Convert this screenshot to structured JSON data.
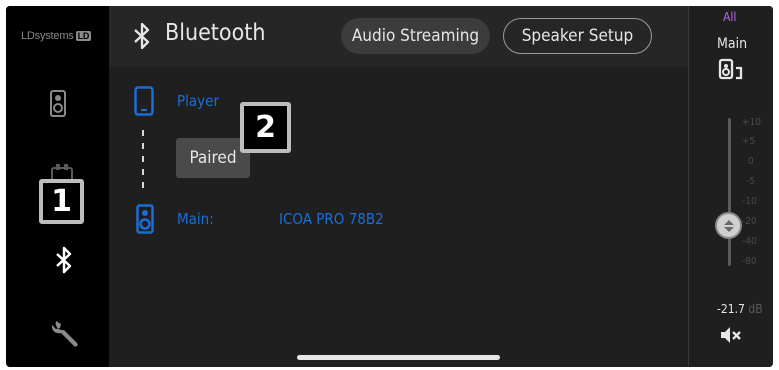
{
  "sidebar": {
    "logo_text": "LDsystems",
    "logo_badge": "LD",
    "items": [
      {
        "icon": "speaker-icon"
      },
      {
        "icon": "speaker-icon"
      },
      {
        "icon": "bluetooth-icon"
      },
      {
        "icon": "wrench-icon"
      }
    ]
  },
  "header": {
    "title": "Bluetooth",
    "tabs": [
      {
        "label": "Audio Streaming",
        "active": true
      },
      {
        "label": "Speaker Setup",
        "active": false
      }
    ]
  },
  "connection": {
    "player_label": "Player",
    "status": "Paired",
    "main_label": "Main:",
    "device_name": "ICOA PRO 78B2"
  },
  "annotations": {
    "badge_1": "1",
    "badge_2": "2"
  },
  "right_panel": {
    "group": "All",
    "channel": "Main",
    "ticks": [
      "+10",
      "+5",
      "0",
      "-5",
      "-10",
      "-20",
      "-40",
      "-80"
    ],
    "level_value": "-21.7",
    "level_unit": "dB"
  },
  "colors": {
    "accent_blue": "#1a6ed8",
    "group_purple": "#b36ce6",
    "background": "#1f1f1f"
  }
}
